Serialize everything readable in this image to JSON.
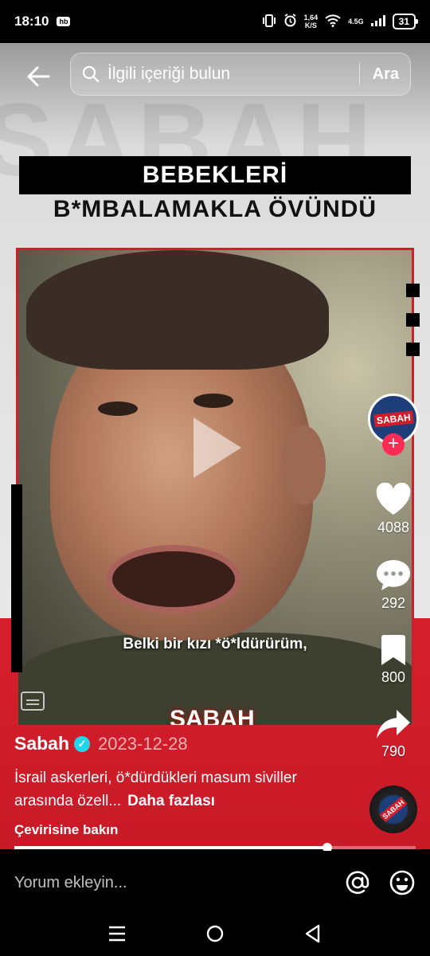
{
  "status": {
    "time": "18:10",
    "app_badge": "hb",
    "net_speed_value": "1,64",
    "net_speed_unit": "K/S",
    "network": "4.5G",
    "battery": "31"
  },
  "search": {
    "placeholder": "İlgili içeriği bulun",
    "submit_label": "Ara"
  },
  "video": {
    "watermark": "SABAH",
    "headline_line1": "BEBEKLERİ",
    "headline_line2": "B*MBALAMAKLA ÖVÜNDÜ",
    "subtitle": "Belki bir kızı *ö*ldürürüm,",
    "logo": "ŞABAH",
    "progress": 0.78
  },
  "actions": {
    "avatar_label": "SABAH",
    "likes": "4088",
    "comments": "292",
    "saves": "800",
    "shares": "790"
  },
  "post": {
    "author": "Sabah",
    "date": "2023-12-28",
    "description": "İsrail askerleri, ö*dürdükleri masum siviller arasında özell...",
    "more_label": "Daha fazlası",
    "translate_label": "Çevirisine bakın"
  },
  "comment": {
    "placeholder": "Yorum ekleyin..."
  },
  "colors": {
    "brand_red": "#d11e2b",
    "follow_pink": "#fe2c55",
    "verified": "#20d5ec"
  }
}
